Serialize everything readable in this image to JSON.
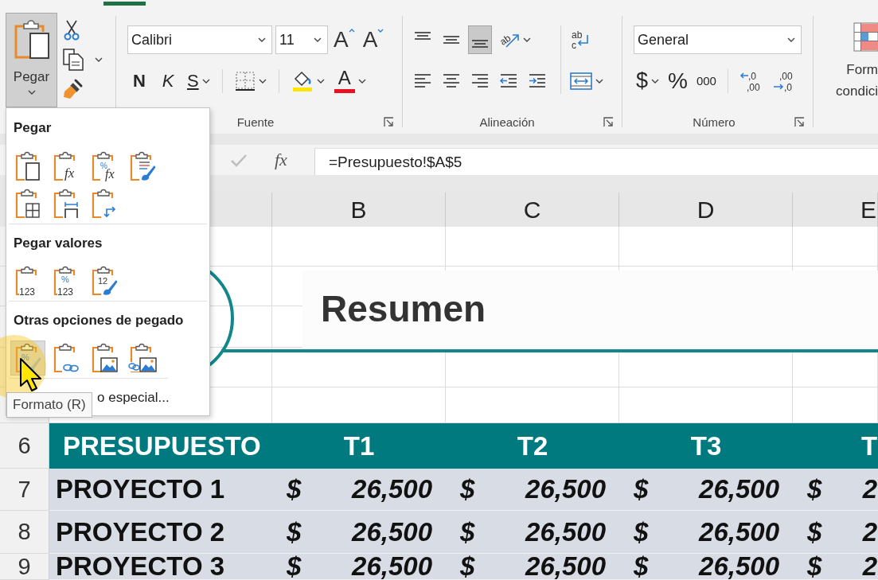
{
  "ribbon": {
    "clipboard": {
      "paste": {
        "label": "Pegar",
        "pressed": true,
        "menu": true
      },
      "tools": [
        {
          "kind": "cut"
        },
        {
          "kind": "copy",
          "menu": true
        },
        {
          "kind": "painter"
        }
      ]
    },
    "font": {
      "title": "Fuente",
      "font_name": "Calibri",
      "font_size": "11",
      "size_buttons": [
        {
          "kind": "grow",
          "label": "A"
        },
        {
          "kind": "shrink",
          "label": "A"
        }
      ],
      "format_buttons": [
        {
          "kind": "bold",
          "label": "N"
        },
        {
          "kind": "italic",
          "label": "K"
        },
        {
          "kind": "underline",
          "label": "S",
          "menu": true
        },
        {
          "kind": "borders",
          "menu": true
        },
        {
          "kind": "fill",
          "menu": true
        },
        {
          "kind": "font_color",
          "label": "A",
          "menu": true
        }
      ]
    },
    "alignment": {
      "title": "Alineación",
      "top_row": [
        {
          "kind": "align_top",
          "selected": false
        },
        {
          "kind": "align_middle",
          "selected": false
        },
        {
          "kind": "align_bottom",
          "selected": true
        },
        {
          "kind": "orientation",
          "glyph": "ab",
          "menu": true
        }
      ],
      "bottom_row": [
        {
          "kind": "align_left",
          "selected": false
        },
        {
          "kind": "align_center",
          "selected": false
        },
        {
          "kind": "align_right",
          "selected": false
        },
        {
          "kind": "outdent"
        },
        {
          "kind": "indent"
        }
      ],
      "wrap": {
        "glyphs": [
          "ab",
          "c"
        ]
      },
      "merge": {
        "menu": true
      }
    },
    "number": {
      "title": "Número",
      "format": "General",
      "buttons": [
        {
          "kind": "currency",
          "label": "$",
          "menu": true
        },
        {
          "kind": "percent",
          "label": "%"
        },
        {
          "kind": "thousands",
          "label": "000"
        },
        {
          "kind": "increase_decimal",
          "glyphs": [
            ",0",
            ",00"
          ]
        },
        {
          "kind": "decrease_decimal",
          "glyphs": [
            ",00",
            ",0"
          ]
        }
      ]
    },
    "styles": {
      "conditional_format": [
        "Form",
        "condici"
      ]
    }
  },
  "formula_bar": {
    "function_label": "fx",
    "formula": "=Presupuesto!$A$5"
  },
  "columns": [
    "B",
    "C",
    "D",
    "E"
  ],
  "banner": {
    "title": "Resumen"
  },
  "table": {
    "header": {
      "row": "6",
      "cells": [
        "PRESUPUESTO",
        "T1",
        "T2",
        "T3",
        "T"
      ]
    },
    "rows": [
      {
        "row": "7",
        "label": "PROYECTO 1",
        "amounts": [
          {
            "currency": "$",
            "value": "26,500"
          },
          {
            "currency": "$",
            "value": "26,500"
          },
          {
            "currency": "$",
            "value": "26,500"
          },
          {
            "currency": "$",
            "value": "2"
          }
        ]
      },
      {
        "row": "8",
        "label": "PROYECTO 2",
        "amounts": [
          {
            "currency": "$",
            "value": "26,500"
          },
          {
            "currency": "$",
            "value": "26,500"
          },
          {
            "currency": "$",
            "value": "26,500"
          },
          {
            "currency": "$",
            "value": "2"
          }
        ]
      },
      {
        "row": "9",
        "label": "PROYECTO 3",
        "amounts": [
          {
            "currency": "$",
            "value": "26,500"
          },
          {
            "currency": "$",
            "value": "26,500"
          },
          {
            "currency": "$",
            "value": "26,500"
          },
          {
            "currency": "$",
            "value": "2"
          }
        ]
      }
    ]
  },
  "paste_menu": {
    "sections": [
      {
        "title": "Pegar",
        "options": [
          {
            "kind": "paste",
            "selected": false
          },
          {
            "kind": "formulas",
            "glyphs": [
              "fx"
            ],
            "selected": false
          },
          {
            "kind": "formulas_number",
            "glyphs": [
              "%",
              "fx"
            ],
            "selected": false
          },
          {
            "kind": "source_format",
            "selected": false
          },
          {
            "kind": "no_borders",
            "selected": false
          },
          {
            "kind": "column_widths",
            "selected": false
          },
          {
            "kind": "transpose",
            "selected": false
          }
        ]
      },
      {
        "title": "Pegar valores",
        "options": [
          {
            "kind": "values",
            "glyphs": [
              "123"
            ],
            "selected": false
          },
          {
            "kind": "values_number",
            "glyphs": [
              "%",
              "123"
            ],
            "selected": false
          },
          {
            "kind": "values_source",
            "glyphs": [
              "12"
            ],
            "selected": false
          }
        ]
      },
      {
        "title": "Otras opciones de pegado",
        "options": [
          {
            "kind": "formatting",
            "glyphs": [
              "%"
            ],
            "selected": true
          },
          {
            "kind": "link",
            "selected": false
          },
          {
            "kind": "picture",
            "selected": false
          },
          {
            "kind": "linked_picture",
            "selected": false
          }
        ]
      }
    ],
    "footer_item": "o especial..."
  },
  "tooltip": "Formato (R)"
}
